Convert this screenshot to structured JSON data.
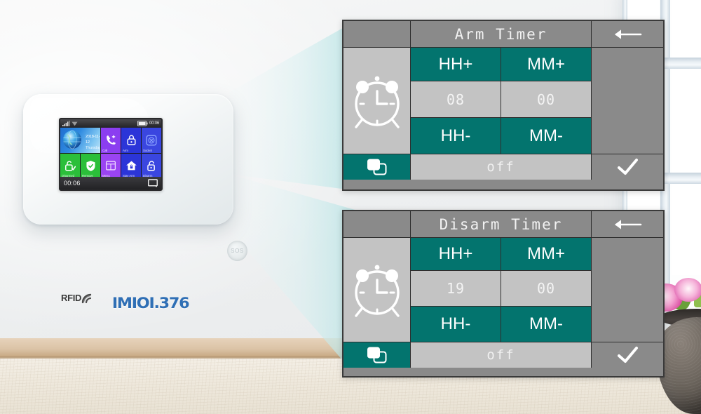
{
  "scene": {
    "description": "Wall-mounted WiFi alarm panel product shot with two projected UI screens",
    "accent_teal": "#03746e",
    "panel_gray": "#8a8a8a",
    "panel_lightgray": "#c3c3c3",
    "brand_blue": "#2f6fb5",
    "beam_color": "#c8eaea"
  },
  "device": {
    "brand_text": "IMIOI.376",
    "rfid_label": "RFID",
    "sos_label": "SOS",
    "statusbar": {
      "signal_icon": "signal-bars-icon",
      "wifi_icon": "wifi-icon",
      "battery_icon": "battery-icon",
      "time": "00:06"
    },
    "home": {
      "date": "2018-11-12",
      "weekday": "Thursday",
      "tiles": [
        {
          "label": "",
          "icon": "globe-icon",
          "color": "#2a7fd4",
          "wide": true
        },
        {
          "label": "Call",
          "icon": "phone-icon",
          "color": "#8b3ef0"
        },
        {
          "label": "Arm",
          "icon": "lock-closed-icon",
          "color": "#2b35d8"
        },
        {
          "label": "Socket",
          "icon": "socket-icon",
          "color": "#3a46e0"
        },
        {
          "label": "Disarmed",
          "icon": "unlock-check-icon",
          "color": "#2bbf3a"
        },
        {
          "label": "Remove",
          "icon": "shield-icon",
          "color": "#2bbf3a"
        },
        {
          "label": "Menu",
          "icon": "menu-card-icon",
          "color": "#9a44f2"
        },
        {
          "label": "Stay Arm",
          "icon": "home-arm-icon",
          "color": "#2b35d8"
        },
        {
          "label": "Disarm",
          "icon": "unlock-icon",
          "color": "#3a46e0"
        }
      ]
    },
    "navbar": {
      "time": "00:06",
      "right_icon": "screen-icon"
    }
  },
  "panels": [
    {
      "id": "arm",
      "title": "Arm Timer",
      "back_icon": "back-arrow-icon",
      "clock_icon": "alarm-clock-icon",
      "toggle_icon": "switch-toggle-icon",
      "confirm_icon": "check-icon",
      "buttons": {
        "hour_up": "HH+",
        "minute_up": "MM+",
        "hour_down": "HH-",
        "minute_down": "MM-"
      },
      "values": {
        "hour": "08",
        "minute": "00"
      },
      "status": "off"
    },
    {
      "id": "disarm",
      "title": "Disarm Timer",
      "back_icon": "back-arrow-icon",
      "clock_icon": "alarm-clock-icon",
      "toggle_icon": "switch-toggle-icon",
      "confirm_icon": "check-icon",
      "buttons": {
        "hour_up": "HH+",
        "minute_up": "MM+",
        "hour_down": "HH-",
        "minute_down": "MM-"
      },
      "values": {
        "hour": "19",
        "minute": "00"
      },
      "status": "off"
    }
  ]
}
